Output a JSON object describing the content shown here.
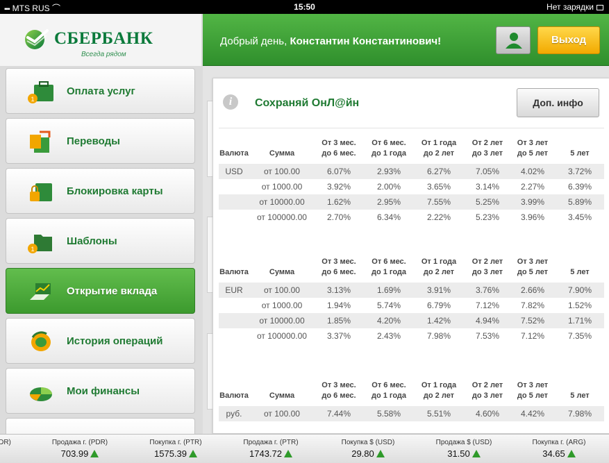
{
  "status_bar": {
    "carrier": "MTS RUS",
    "time": "15:50",
    "battery": "Нет зарядки"
  },
  "brand": {
    "name": "СБЕРБАНК",
    "slogan": "Всегда рядом"
  },
  "header": {
    "greeting": "Добрый день,",
    "user_name": "Константин Константинович!",
    "exit_label": "Выход"
  },
  "sidebar": {
    "items": [
      {
        "label": "Оплата услуг",
        "icon": "briefcase-coins-icon",
        "active": false
      },
      {
        "label": "Переводы",
        "icon": "transfer-arrows-icon",
        "active": false
      },
      {
        "label": "Блокировка карты",
        "icon": "card-lock-icon",
        "active": false
      },
      {
        "label": "Шаблоны",
        "icon": "folder-icon",
        "active": false
      },
      {
        "label": "Открытие вклада",
        "icon": "deposit-chart-icon",
        "active": true
      },
      {
        "label": "История операций",
        "icon": "history-icon",
        "active": false
      },
      {
        "label": "Мои финансы",
        "icon": "pie-chart-icon",
        "active": false
      }
    ]
  },
  "panel": {
    "title": "Сохраняй ОнЛ@йн",
    "more_button": "Доп. инфо",
    "columns": [
      "Валюта",
      "Сумма",
      "От 3 мес.\nдо 6 мес.",
      "От 6 мес.\nдо 1 года",
      "От 1 года\nдо 2 лет",
      "От 2 лет\nдо 3 лет",
      "От 3 лет\nдо 5 лет",
      "5 лет"
    ],
    "tables": [
      {
        "currency": "USD",
        "rows": [
          {
            "amount": "от 100.00",
            "rates": [
              "6.07%",
              "2.93%",
              "6.27%",
              "7.05%",
              "4.02%",
              "3.72%"
            ]
          },
          {
            "amount": "от 1000.00",
            "rates": [
              "3.92%",
              "2.00%",
              "3.65%",
              "3.14%",
              "2.27%",
              "6.39%"
            ]
          },
          {
            "amount": "от 10000.00",
            "rates": [
              "1.62%",
              "2.95%",
              "7.55%",
              "5.25%",
              "3.99%",
              "5.89%"
            ]
          },
          {
            "amount": "от 100000.00",
            "rates": [
              "2.70%",
              "6.34%",
              "2.22%",
              "5.23%",
              "3.96%",
              "3.45%"
            ]
          }
        ]
      },
      {
        "currency": "EUR",
        "rows": [
          {
            "amount": "от 100.00",
            "rates": [
              "3.13%",
              "1.69%",
              "3.91%",
              "3.76%",
              "2.66%",
              "7.90%"
            ]
          },
          {
            "amount": "от 1000.00",
            "rates": [
              "1.94%",
              "5.74%",
              "6.79%",
              "7.12%",
              "7.82%",
              "1.52%"
            ]
          },
          {
            "amount": "от 10000.00",
            "rates": [
              "1.85%",
              "4.20%",
              "1.42%",
              "4.94%",
              "7.52%",
              "1.71%"
            ]
          },
          {
            "amount": "от 100000.00",
            "rates": [
              "3.37%",
              "2.43%",
              "7.98%",
              "7.53%",
              "7.12%",
              "7.35%"
            ]
          }
        ]
      },
      {
        "currency": "руб.",
        "rows": [
          {
            "amount": "от 100.00",
            "rates": [
              "7.44%",
              "5.58%",
              "5.51%",
              "4.60%",
              "4.42%",
              "7.98%"
            ]
          }
        ]
      }
    ]
  },
  "ticker": [
    {
      "label": "DR)",
      "value": ""
    },
    {
      "label": "Продажа г. (PDR)",
      "value": "703.99"
    },
    {
      "label": "Покупка г. (PTR)",
      "value": "1575.39"
    },
    {
      "label": "Продажа г. (PTR)",
      "value": "1743.72"
    },
    {
      "label": "Покупка $ (USD)",
      "value": "29.80"
    },
    {
      "label": "Продажа $ (USD)",
      "value": "31.50"
    },
    {
      "label": "Покупка г. (ARG)",
      "value": "34.65"
    }
  ],
  "colors": {
    "brand_green": "#1f7a32",
    "header_green": "#3f9f36",
    "exit_yellow": "#f5b400",
    "up_arrow": "#2f9a2a"
  }
}
